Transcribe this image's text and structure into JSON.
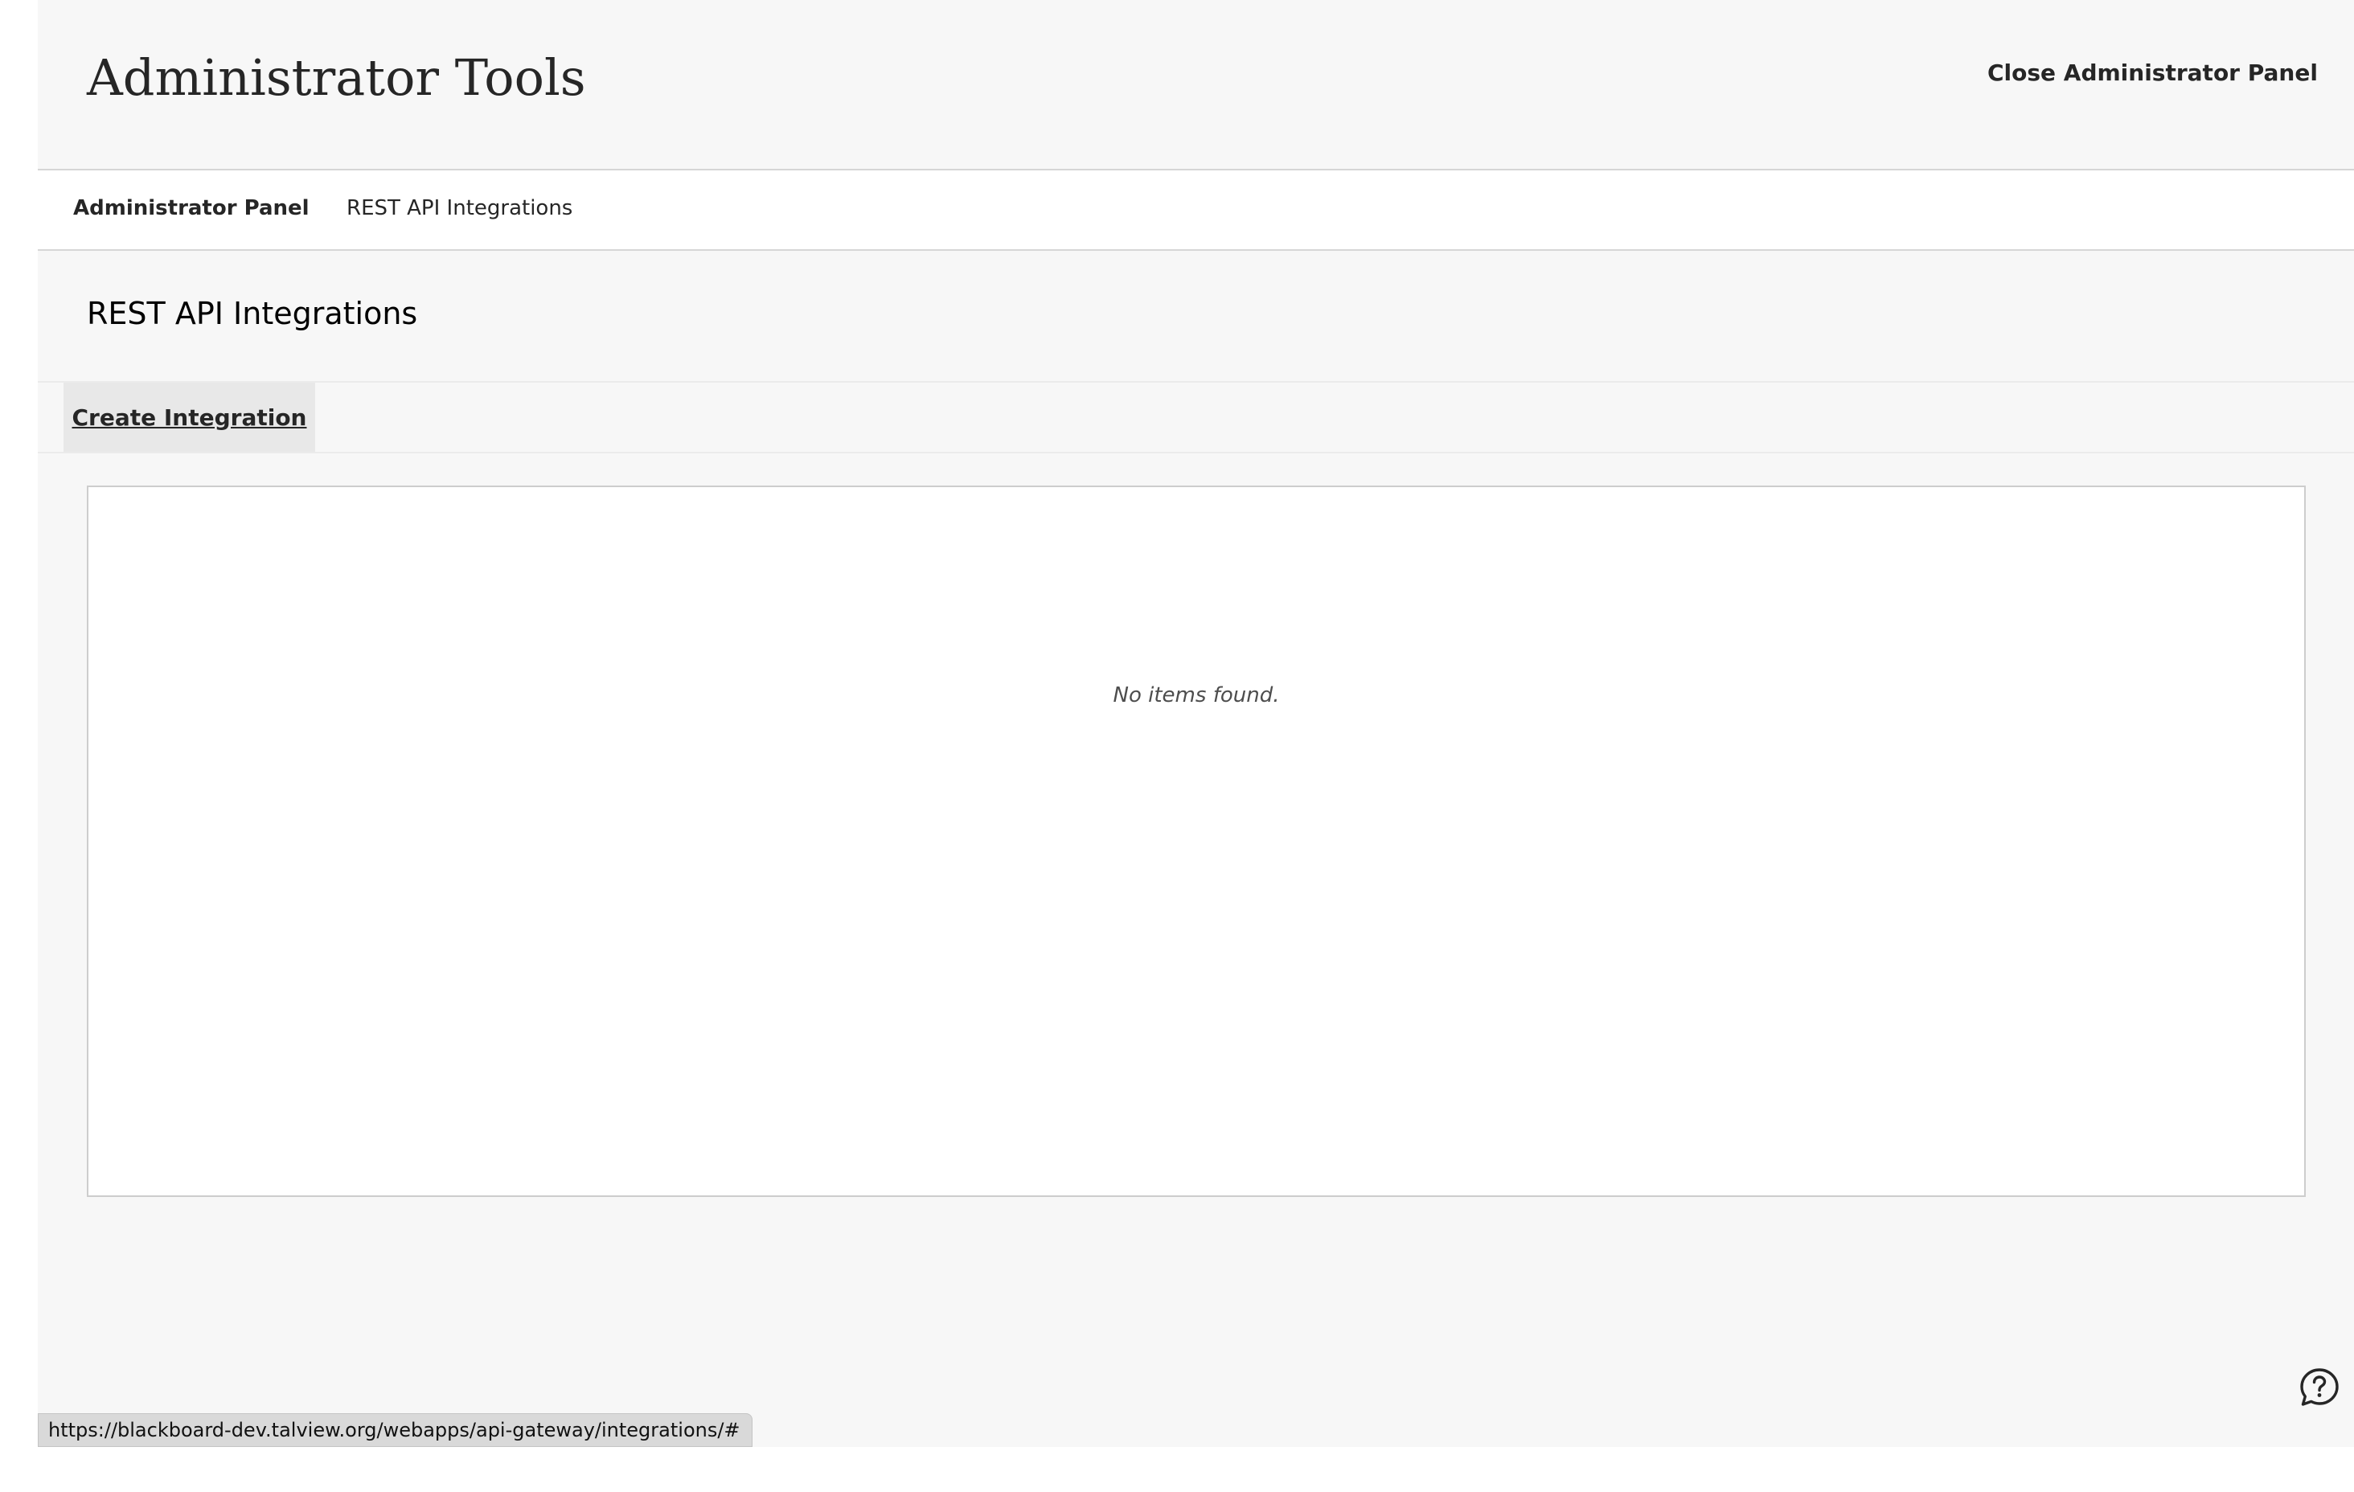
{
  "header": {
    "title": "Administrator Tools",
    "close_label": "Close Administrator Panel"
  },
  "breadcrumb": {
    "items": [
      {
        "label": "Administrator Panel"
      },
      {
        "label": "REST API Integrations"
      }
    ]
  },
  "main": {
    "section_title": "REST API Integrations",
    "create_button_label": "Create Integration",
    "empty_message": "No items found."
  },
  "help": {
    "icon": "help-circle-icon"
  },
  "status_bar": {
    "url": "https://blackboard-dev.talview.org/webapps/api-gateway/integrations/#"
  }
}
